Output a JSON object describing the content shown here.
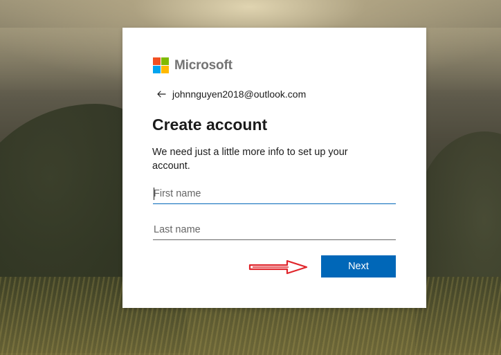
{
  "brand": {
    "name": "Microsoft",
    "logo_colors": [
      "#f25022",
      "#7fba00",
      "#00a4ef",
      "#ffb900"
    ]
  },
  "identity": {
    "email": "johnnguyen2018@outlook.com",
    "back_icon": "back-arrow-icon"
  },
  "form": {
    "title": "Create account",
    "description": "We need just a little more info to set up your account.",
    "first_name": {
      "placeholder": "First name",
      "value": ""
    },
    "last_name": {
      "placeholder": "Last name",
      "value": ""
    },
    "next_label": "Next"
  },
  "annotation": {
    "icon": "red-arrow-pointer",
    "color": "#e0252b"
  },
  "colors": {
    "accent": "#0067b8",
    "card_background": "#ffffff",
    "text": "#1b1b1b"
  }
}
